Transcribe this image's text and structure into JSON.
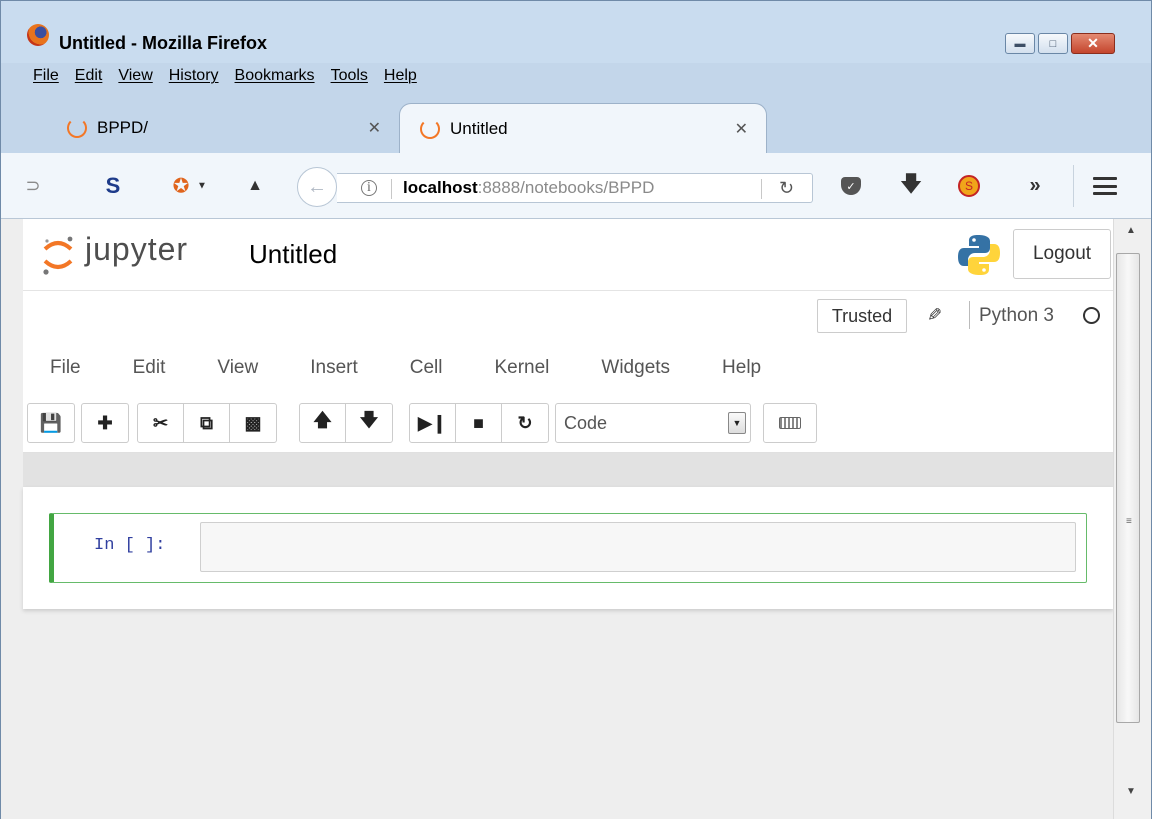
{
  "window": {
    "title": "Untitled - Mozilla Firefox",
    "menus": [
      "File",
      "Edit",
      "View",
      "History",
      "Bookmarks",
      "Tools",
      "Help"
    ]
  },
  "tabs": [
    {
      "label": "BPPD/",
      "active": false
    },
    {
      "label": "Untitled",
      "active": true
    }
  ],
  "urlbar": {
    "host": "localhost",
    "rest": ":8888/notebooks/BPPD"
  },
  "jupyter": {
    "brand": "jupyter",
    "notebook_title": "Untitled",
    "logout_label": "Logout",
    "trusted_label": "Trusted",
    "kernel_name": "Python 3",
    "menus": [
      "File",
      "Edit",
      "View",
      "Insert",
      "Cell",
      "Kernel",
      "Widgets",
      "Help"
    ],
    "cell_type": "Code",
    "cell_prompt": "In [ ]:"
  },
  "colors": {
    "jupyter_orange": "#f37726",
    "cell_selected_border": "#42a642",
    "prompt_blue": "#303f9f"
  }
}
